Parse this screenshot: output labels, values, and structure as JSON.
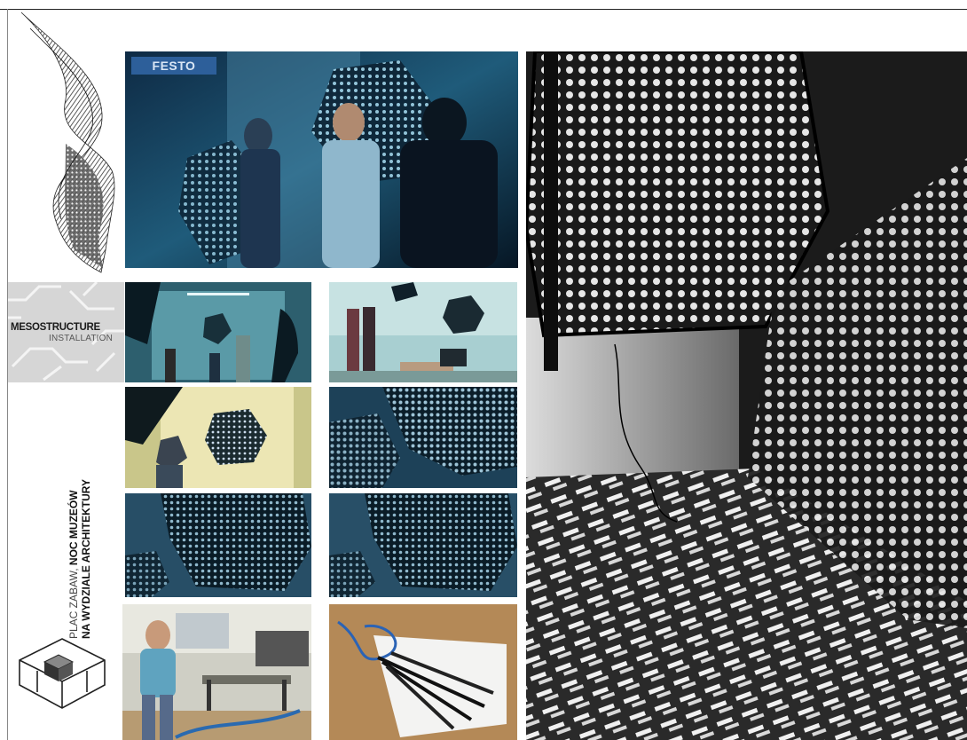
{
  "badge": {
    "text": "FESTO"
  },
  "mesostructure": {
    "title": "MESOSTRUCTURE",
    "subtitle": "INSTALLATION"
  },
  "event": {
    "line1_light": "PLAC ZABAW, ",
    "line1_bold": "NOC MUZEÓW",
    "line2": "NA WYDZIALE ARCHITEKTURY"
  },
  "icons": {
    "logo": "isometric-cube-logo-icon",
    "sketch": "twisted-ribbon-sketch-icon"
  }
}
